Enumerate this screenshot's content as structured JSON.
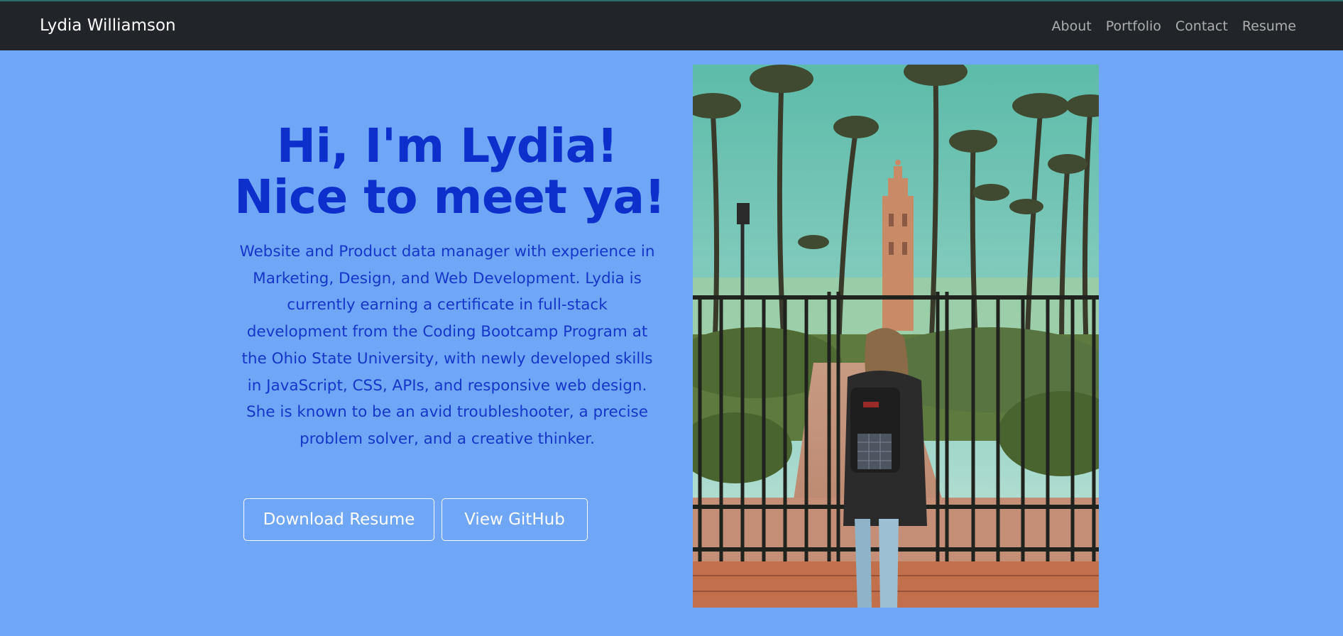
{
  "navbar": {
    "brand": "Lydia Williamson",
    "links": [
      "About",
      "Portfolio",
      "Contact",
      "Resume"
    ]
  },
  "hero": {
    "headline_line1": "Hi, I'm Lydia!",
    "headline_line2": "Nice to meet ya!",
    "bio": "Website and Product data manager with experience in Marketing, Design, and Web Development. Lydia is currently earning a certificate in full-stack development from the Coding Bootcamp Program at the Ohio State University, with newly developed skills in JavaScript, CSS, APIs, and responsive web design. She is known to be an avid troubleshooter, a precise problem solver, and a creative thinker.",
    "buttons": {
      "resume": "Download Resume",
      "github": "View GitHub"
    }
  },
  "colors": {
    "page_background": "#6fa6f5",
    "navbar": "#212529",
    "heading_text": "#0d2fcb",
    "button_border": "#ffffff"
  }
}
